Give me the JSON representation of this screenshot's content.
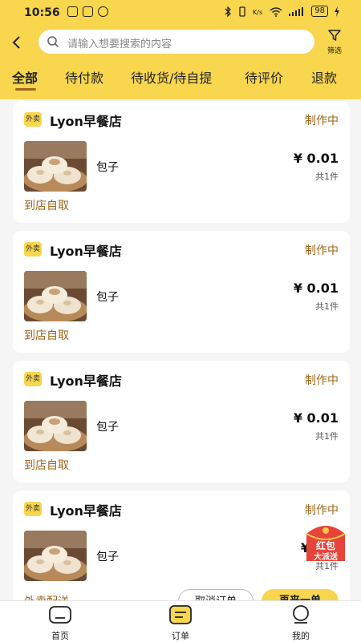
{
  "status_bar": {
    "time": "10:56",
    "battery": "98"
  },
  "search": {
    "placeholder": "请输入想要搜索的内容",
    "filter_label": "筛选"
  },
  "tabs": [
    {
      "label": "全部",
      "active": true
    },
    {
      "label": "待付款"
    },
    {
      "label": "待收货/待自提"
    },
    {
      "label": "待评价"
    },
    {
      "label": "退款"
    }
  ],
  "orders": [
    {
      "badge": "外卖",
      "shop": "Lyon早餐店",
      "status": "制作中",
      "product": "包子",
      "price": "¥ 0.01",
      "qty": "共1件",
      "delivery": "到店自取"
    },
    {
      "badge": "外卖",
      "shop": "Lyon早餐店",
      "status": "制作中",
      "product": "包子",
      "price": "¥ 0.01",
      "qty": "共1件",
      "delivery": "到店自取"
    },
    {
      "badge": "外卖",
      "shop": "Lyon早餐店",
      "status": "制作中",
      "product": "包子",
      "price": "¥ 0.01",
      "qty": "共1件",
      "delivery": "到店自取"
    },
    {
      "badge": "外卖",
      "shop": "Lyon早餐店",
      "status": "制作中",
      "product": "包子",
      "price": "¥",
      "qty": "共1件",
      "delivery": "外卖配送"
    }
  ],
  "actions": {
    "cancel": "取消订单",
    "reorder": "再来一单"
  },
  "float_badge": {
    "line1": "红包",
    "line2": "大派送"
  },
  "nav": [
    {
      "label": "首页",
      "icon": "home-icon"
    },
    {
      "label": "订单",
      "icon": "order-icon"
    },
    {
      "label": "我的",
      "icon": "profile-icon"
    }
  ],
  "colors": {
    "header": "#f8d64e",
    "accent": "#a0651a",
    "background": "#f5f5f5"
  }
}
